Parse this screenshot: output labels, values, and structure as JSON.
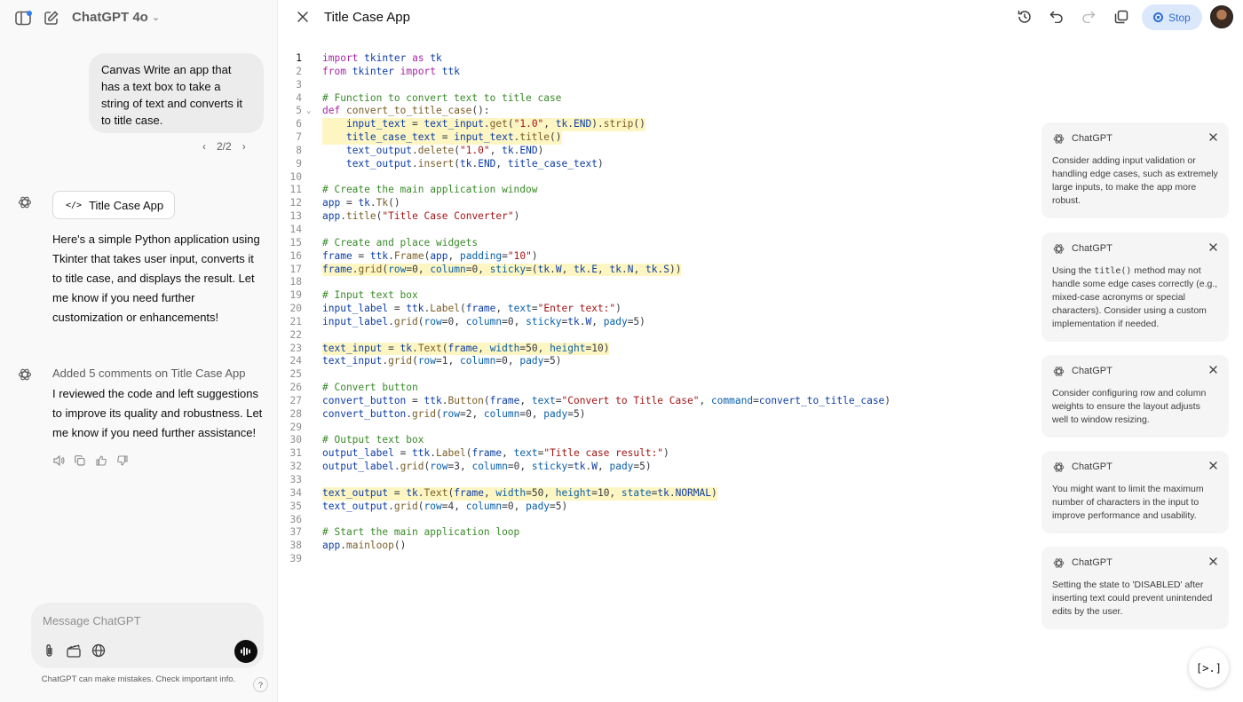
{
  "chat": {
    "model_name": "ChatGPT 4o",
    "user_message": "Canvas Write an app that has a text box to take a string of text and converts it to title case.",
    "pager": "2/2",
    "canvas_chip_label": "Title Case App",
    "assistant_message_1": "Here's a simple Python application using Tkinter that takes user input, converts it to title case, and displays the result. Let me know if you need further customization or enhancements!",
    "comments_meta": "Added 5 comments on Title Case App",
    "assistant_message_2": "I reviewed the code and left suggestions to improve its quality and robustness. Let me know if you need further assistance!",
    "composer_placeholder": "Message ChatGPT",
    "disclaimer": "ChatGPT can make mistakes. Check important info.",
    "help_label": "?"
  },
  "canvas": {
    "title": "Title Case App",
    "stop_label": "Stop",
    "fab_label": "[>.]",
    "code_lines": [
      "import tkinter as tk",
      "from tkinter import ttk",
      "",
      "# Function to convert text to title case",
      "def convert_to_title_case():",
      "    input_text = text_input.get(\"1.0\", tk.END).strip()",
      "    title_case_text = input_text.title()",
      "    text_output.delete(\"1.0\", tk.END)",
      "    text_output.insert(tk.END, title_case_text)",
      "",
      "# Create the main application window",
      "app = tk.Tk()",
      "app.title(\"Title Case Converter\")",
      "",
      "# Create and place widgets",
      "frame = ttk.Frame(app, padding=\"10\")",
      "frame.grid(row=0, column=0, sticky=(tk.W, tk.E, tk.N, tk.S))",
      "",
      "# Input text box",
      "input_label = ttk.Label(frame, text=\"Enter text:\")",
      "input_label.grid(row=0, column=0, sticky=tk.W, pady=5)",
      "",
      "text_input = tk.Text(frame, width=50, height=10)",
      "text_input.grid(row=1, column=0, pady=5)",
      "",
      "# Convert button",
      "convert_button = ttk.Button(frame, text=\"Convert to Title Case\", command=convert_to_title_case)",
      "convert_button.grid(row=2, column=0, pady=5)",
      "",
      "# Output text box",
      "output_label = ttk.Label(frame, text=\"Title case result:\")",
      "output_label.grid(row=3, column=0, sticky=tk.W, pady=5)",
      "",
      "text_output = tk.Text(frame, width=50, height=10, state=tk.NORMAL)",
      "text_output.grid(row=4, column=0, pady=5)",
      "",
      "# Start the main application loop",
      "app.mainloop()",
      ""
    ],
    "highlighted_lines": [
      6,
      7,
      17,
      23,
      34
    ],
    "comments": [
      {
        "author": "ChatGPT",
        "text": "Consider adding input validation or handling edge cases, such as extremely large inputs, to make the app more robust."
      },
      {
        "author": "ChatGPT",
        "text": "Using the title() method may not handle some edge cases correctly (e.g., mixed-case acronyms or special characters). Consider using a custom implementation if needed."
      },
      {
        "author": "ChatGPT",
        "text": "Consider configuring row and column weights to ensure the layout adjusts well to window resizing."
      },
      {
        "author": "ChatGPT",
        "text": "You might want to limit the maximum number of characters in the input to improve performance and usability."
      },
      {
        "author": "ChatGPT",
        "text": "Setting the state to 'DISABLED' after inserting text could prevent unintended edits by the user."
      }
    ]
  }
}
